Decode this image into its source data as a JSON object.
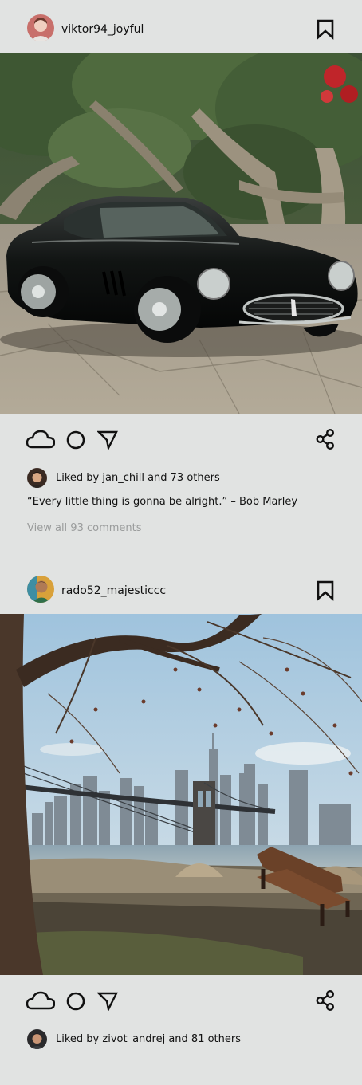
{
  "posts": [
    {
      "username": "viktor94_joyful",
      "liked_by_prefix": "Liked by ",
      "liked_by_user": "jan_chill",
      "liked_by_suffix": " and 73 others",
      "caption": "“Every little thing is gonna be alright.” – Bob Marley",
      "comments_link": "View all 93 comments",
      "photo_subject": "Black vintage sports car parked under trees on a stone plaza"
    },
    {
      "username": "rado52_majesticcc",
      "liked_by_prefix": "Liked by ",
      "liked_by_user": "zivot_andrej",
      "liked_by_suffix": " and 81 others",
      "photo_subject": "City skyline and bridge seen from a waterfront park with a bench and bare tree"
    }
  ],
  "icons": {
    "bookmark": "bookmark-icon",
    "like": "cloud-icon",
    "comment": "circle-icon",
    "send": "send-arrow-icon",
    "share": "share-icon"
  },
  "colors": {
    "background": "#e1e3e2",
    "text": "#111111",
    "muted": "#9a9c9c"
  }
}
